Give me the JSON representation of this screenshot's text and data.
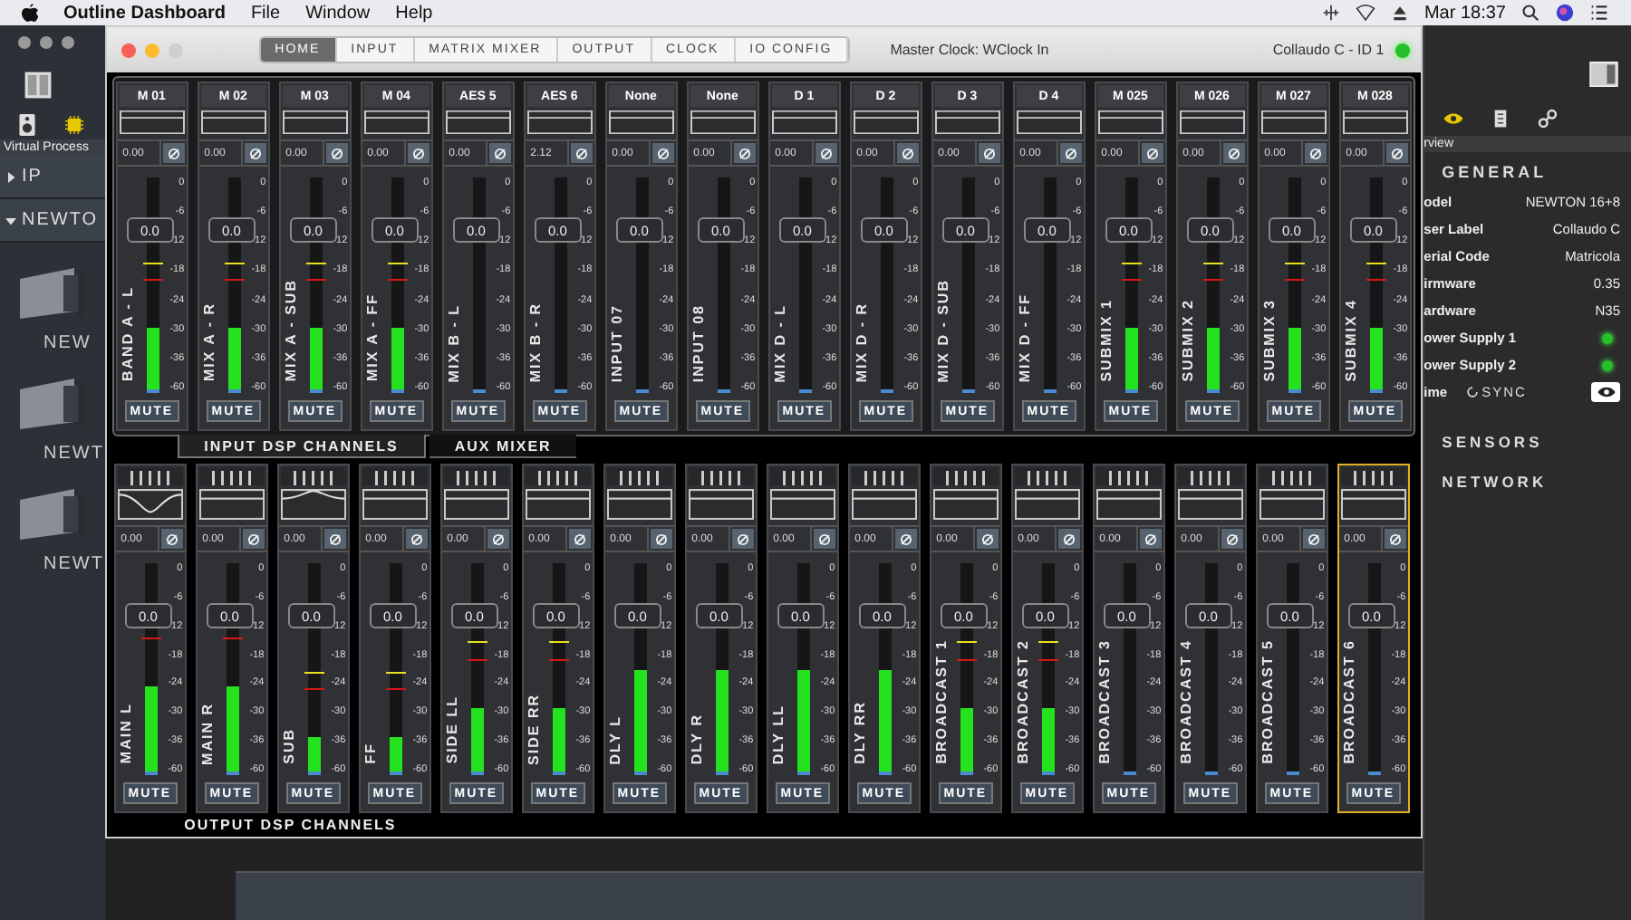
{
  "menubar": {
    "app": "Outline Dashboard",
    "menus": [
      "File",
      "Window",
      "Help"
    ],
    "clock": "Mar 18:37"
  },
  "sidebar": {
    "caption": "Virtual Process",
    "items": [
      {
        "label": "IP",
        "expanded": false
      },
      {
        "label": "NEWTO",
        "expanded": true
      }
    ],
    "devices": [
      "NEW",
      "NEWT",
      "NEWT"
    ]
  },
  "window": {
    "tabs": [
      {
        "label": "HOME",
        "selected": true
      },
      {
        "label": "INPUT",
        "selected": false
      },
      {
        "label": "MATRIX MIXER",
        "selected": false
      },
      {
        "label": "OUTPUT",
        "selected": false
      },
      {
        "label": "CLOCK",
        "selected": false
      },
      {
        "label": "IO CONFIG",
        "selected": false
      }
    ],
    "master_clock": "Master Clock: WClock In",
    "device": "Collaudo C - ID 1",
    "online": true
  },
  "mixer": {
    "sections": [
      {
        "kind": "input",
        "tabs": [
          {
            "label": "INPUT DSP CHANNELS",
            "selected": true
          },
          {
            "label": "AUX MIXER",
            "selected": false
          }
        ],
        "strips": [
          {
            "header": "M 01",
            "gain": "0.00",
            "fader": "0.0",
            "name": "BAND A - L",
            "level": 0.3,
            "mute": "MUTE",
            "scale": [
              "0",
              "-6",
              "-12",
              "-18",
              "-24",
              "-30",
              "-36",
              "-60"
            ]
          },
          {
            "header": "M 02",
            "gain": "0.00",
            "fader": "0.0",
            "name": "MIX A - R",
            "level": 0.3,
            "mute": "MUTE",
            "scale": [
              "0",
              "-6",
              "-12",
              "-18",
              "-24",
              "-30",
              "-36",
              "-60"
            ]
          },
          {
            "header": "M 03",
            "gain": "0.00",
            "fader": "0.0",
            "name": "MIX A - SUB",
            "level": 0.3,
            "mute": "MUTE",
            "scale": [
              "0",
              "-6",
              "-12",
              "-18",
              "-24",
              "-30",
              "-36",
              "-60"
            ]
          },
          {
            "header": "M 04",
            "gain": "0.00",
            "fader": "0.0",
            "name": "MIX A - FF",
            "level": 0.3,
            "mute": "MUTE",
            "scale": [
              "0",
              "-6",
              "-12",
              "-18",
              "-24",
              "-30",
              "-36",
              "-60"
            ]
          },
          {
            "header": "AES 5",
            "gain": "0.00",
            "fader": "0.0",
            "name": "MIX B - L",
            "level": 0,
            "mute": "MUTE",
            "scale": [
              "0",
              "-6",
              "-12",
              "-18",
              "-24",
              "-30",
              "-36",
              "-60"
            ]
          },
          {
            "header": "AES 6",
            "gain": "2.12",
            "fader": "0.0",
            "name": "MIX B - R",
            "level": 0,
            "mute": "MUTE",
            "scale": [
              "0",
              "-6",
              "-12",
              "-18",
              "-24",
              "-30",
              "-36",
              "-60"
            ]
          },
          {
            "header": "None",
            "gain": "0.00",
            "fader": "0.0",
            "name": "INPUT 07",
            "level": 0,
            "mute": "MUTE",
            "scale": [
              "0",
              "-6",
              "-12",
              "-18",
              "-24",
              "-30",
              "-36",
              "-60"
            ]
          },
          {
            "header": "None",
            "gain": "0.00",
            "fader": "0.0",
            "name": "INPUT 08",
            "level": 0,
            "mute": "MUTE",
            "scale": [
              "0",
              "-6",
              "-12",
              "-18",
              "-24",
              "-30",
              "-36",
              "-60"
            ]
          },
          {
            "header": "D 1",
            "gain": "0.00",
            "fader": "0.0",
            "name": "MIX D - L",
            "level": 0,
            "mute": "MUTE",
            "scale": [
              "0",
              "-6",
              "-12",
              "-18",
              "-24",
              "-30",
              "-36",
              "-60"
            ]
          },
          {
            "header": "D 2",
            "gain": "0.00",
            "fader": "0.0",
            "name": "MIX D - R",
            "level": 0,
            "mute": "MUTE",
            "scale": [
              "0",
              "-6",
              "-12",
              "-18",
              "-24",
              "-30",
              "-36",
              "-60"
            ]
          },
          {
            "header": "D 3",
            "gain": "0.00",
            "fader": "0.0",
            "name": "MIX D - SUB",
            "level": 0,
            "mute": "MUTE",
            "scale": [
              "0",
              "-6",
              "-12",
              "-18",
              "-24",
              "-30",
              "-36",
              "-60"
            ]
          },
          {
            "header": "D 4",
            "gain": "0.00",
            "fader": "0.0",
            "name": "MIX D - FF",
            "level": 0,
            "mute": "MUTE",
            "scale": [
              "0",
              "-6",
              "-12",
              "-18",
              "-24",
              "-30",
              "-36",
              "-60"
            ]
          },
          {
            "header": "M 025",
            "gain": "0.00",
            "fader": "0.0",
            "name": "SUBMIX 1",
            "level": 0.3,
            "mute": "MUTE",
            "scale": [
              "0",
              "-6",
              "-12",
              "-18",
              "-24",
              "-30",
              "-36",
              "-60"
            ]
          },
          {
            "header": "M 026",
            "gain": "0.00",
            "fader": "0.0",
            "name": "SUBMIX 2",
            "level": 0.3,
            "mute": "MUTE",
            "scale": [
              "0",
              "-6",
              "-12",
              "-18",
              "-24",
              "-30",
              "-36",
              "-60"
            ]
          },
          {
            "header": "M 027",
            "gain": "0.00",
            "fader": "0.0",
            "name": "SUBMIX 3",
            "level": 0.3,
            "mute": "MUTE",
            "scale": [
              "0",
              "-6",
              "-12",
              "-18",
              "-24",
              "-30",
              "-36",
              "-60"
            ]
          },
          {
            "header": "M 028",
            "gain": "0.00",
            "fader": "0.0",
            "name": "SUBMIX 4",
            "level": 0.3,
            "mute": "MUTE",
            "scale": [
              "0",
              "-6",
              "-12",
              "-18",
              "-24",
              "-30",
              "-36",
              "-60"
            ]
          }
        ]
      },
      {
        "kind": "output",
        "footer": "OUTPUT DSP CHANNELS",
        "strips": [
          {
            "kind": "notch",
            "gain": "0.00",
            "fader": "0.0",
            "name": "MAIN L",
            "level": 0.42,
            "mute": "MUTE",
            "selected": false,
            "scale": [
              "0",
              "-6",
              "-12",
              "-18",
              "-24",
              "-30",
              "-36",
              "-60"
            ]
          },
          {
            "kind": "flat",
            "gain": "0.00",
            "fader": "0.0",
            "name": "MAIN R",
            "level": 0.42,
            "mute": "MUTE",
            "selected": false,
            "scale": [
              "0",
              "-6",
              "-12",
              "-18",
              "-24",
              "-30",
              "-36",
              "-60"
            ]
          },
          {
            "kind": "peak",
            "gain": "0.00",
            "fader": "0.0",
            "name": "SUB",
            "level": 0.18,
            "mute": "MUTE",
            "selected": false,
            "scale": [
              "0",
              "-6",
              "-12",
              "-18",
              "-24",
              "-30",
              "-36",
              "-60"
            ]
          },
          {
            "kind": "flat",
            "gain": "0.00",
            "fader": "0.0",
            "name": "FF",
            "level": 0.18,
            "mute": "MUTE",
            "selected": false,
            "scale": [
              "0",
              "-6",
              "-12",
              "-18",
              "-24",
              "-30",
              "-36",
              "-60"
            ]
          },
          {
            "kind": "flat",
            "gain": "0.00",
            "fader": "0.0",
            "name": "SIDE LL",
            "level": 0.32,
            "mute": "MUTE",
            "selected": false,
            "scale": [
              "0",
              "-6",
              "-12",
              "-18",
              "-24",
              "-30",
              "-36",
              "-60"
            ]
          },
          {
            "kind": "flat",
            "gain": "0.00",
            "fader": "0.0",
            "name": "SIDE RR",
            "level": 0.32,
            "mute": "MUTE",
            "selected": false,
            "scale": [
              "0",
              "-6",
              "-12",
              "-18",
              "-24",
              "-30",
              "-36",
              "-60"
            ]
          },
          {
            "kind": "flat",
            "gain": "0.00",
            "fader": "0.0",
            "name": "DLY L",
            "level": 0.5,
            "mute": "MUTE",
            "selected": false,
            "scale": [
              "0",
              "-6",
              "-12",
              "-18",
              "-24",
              "-30",
              "-36",
              "-60"
            ]
          },
          {
            "kind": "flat",
            "gain": "0.00",
            "fader": "0.0",
            "name": "DLY R",
            "level": 0.5,
            "mute": "MUTE",
            "selected": false,
            "scale": [
              "0",
              "-6",
              "-12",
              "-18",
              "-24",
              "-30",
              "-36",
              "-60"
            ]
          },
          {
            "kind": "flat",
            "gain": "0.00",
            "fader": "0.0",
            "name": "DLY LL",
            "level": 0.5,
            "mute": "MUTE",
            "selected": false,
            "scale": [
              "0",
              "-6",
              "-12",
              "-18",
              "-24",
              "-30",
              "-36",
              "-60"
            ]
          },
          {
            "kind": "flat",
            "gain": "0.00",
            "fader": "0.0",
            "name": "DLY RR",
            "level": 0.5,
            "mute": "MUTE",
            "selected": false,
            "scale": [
              "0",
              "-6",
              "-12",
              "-18",
              "-24",
              "-30",
              "-36",
              "-60"
            ]
          },
          {
            "kind": "flat",
            "gain": "0.00",
            "fader": "0.0",
            "name": "BROADCAST 1",
            "level": 0.32,
            "mute": "MUTE",
            "selected": false,
            "scale": [
              "0",
              "-6",
              "-12",
              "-18",
              "-24",
              "-30",
              "-36",
              "-60"
            ]
          },
          {
            "kind": "flat",
            "gain": "0.00",
            "fader": "0.0",
            "name": "BROADCAST 2",
            "level": 0.32,
            "mute": "MUTE",
            "selected": false,
            "scale": [
              "0",
              "-6",
              "-12",
              "-18",
              "-24",
              "-30",
              "-36",
              "-60"
            ]
          },
          {
            "kind": "flat",
            "gain": "0.00",
            "fader": "0.0",
            "name": "BROADCAST 3",
            "level": 0,
            "mute": "MUTE",
            "selected": false,
            "scale": [
              "0",
              "-6",
              "-12",
              "-18",
              "-24",
              "-30",
              "-36",
              "-60"
            ]
          },
          {
            "kind": "flat",
            "gain": "0.00",
            "fader": "0.0",
            "name": "BROADCAST 4",
            "level": 0,
            "mute": "MUTE",
            "selected": false,
            "scale": [
              "0",
              "-6",
              "-12",
              "-18",
              "-24",
              "-30",
              "-36",
              "-60"
            ]
          },
          {
            "kind": "flat",
            "gain": "0.00",
            "fader": "0.0",
            "name": "BROADCAST 5",
            "level": 0,
            "mute": "MUTE",
            "selected": false,
            "scale": [
              "0",
              "-6",
              "-12",
              "-18",
              "-24",
              "-30",
              "-36",
              "-60"
            ]
          },
          {
            "kind": "flat",
            "gain": "0.00",
            "fader": "0.0",
            "name": "BROADCAST 6",
            "level": 0,
            "mute": "MUTE",
            "selected": true,
            "scale": [
              "0",
              "-6",
              "-12",
              "-18",
              "-24",
              "-30",
              "-36",
              "-60"
            ]
          }
        ]
      }
    ]
  },
  "overview": {
    "caption": "rview",
    "heading": "GENERAL",
    "rows": [
      {
        "kind": "text",
        "label": "odel",
        "value": "NEWTON 16+8"
      },
      {
        "kind": "text",
        "label": "ser Label",
        "value": "Collaudo C"
      },
      {
        "kind": "text",
        "label": "erial Code",
        "value": "Matricola"
      },
      {
        "kind": "text",
        "label": "irmware",
        "value": "0.35"
      },
      {
        "kind": "text",
        "label": "ardware",
        "value": "N35"
      },
      {
        "kind": "led",
        "label": "ower Supply 1",
        "on": true
      },
      {
        "kind": "led",
        "label": "ower Supply 2",
        "on": true
      },
      {
        "kind": "sync",
        "label": "ime",
        "value": "SYNC"
      }
    ],
    "sections": [
      "SENSORS",
      "NETWORK"
    ]
  }
}
